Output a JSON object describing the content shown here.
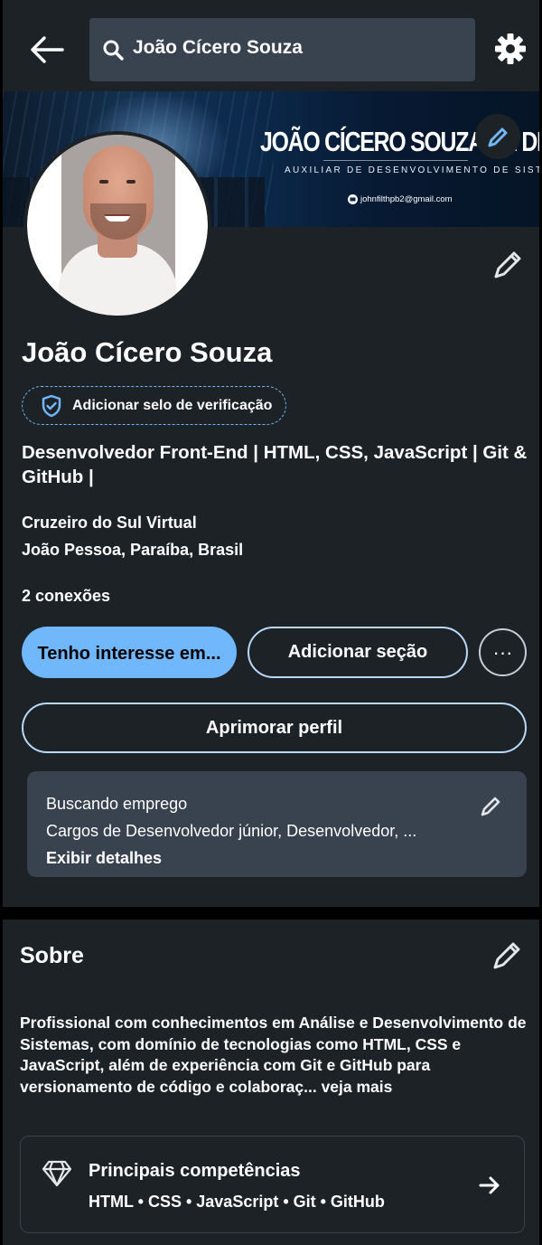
{
  "colors": {
    "page_bg": "#1d2226",
    "accent": "#71b7fb",
    "field_bg": "#38434f"
  },
  "header": {
    "back_icon": "arrow-left-icon",
    "search_value": "João Cícero Souza",
    "search_icon": "search-icon",
    "settings_icon": "gear-icon"
  },
  "banner": {
    "title": "JOÃO CÍCERO SOUZA DE DEUS",
    "subtitle": "AUXILIAR DE DESENVOLVIMENTO DE SISTEMAS",
    "email": "johnfilthpb2@gmail.com"
  },
  "profile": {
    "name": "João Cícero Souza",
    "verify_label": "Adicionar selo de verificação",
    "headline": "Desenvolvedor Front-End | HTML, CSS, JavaScript | Git & GitHub |",
    "school": "Cruzeiro do Sul Virtual",
    "location": "João Pessoa, Paraíba, Brasil",
    "connections": "2 conexões",
    "btn_interest": "Tenho interesse em...",
    "btn_add_section": "Adicionar seção",
    "btn_more": "···",
    "btn_improve": "Aprimorar perfil"
  },
  "job": {
    "title": "Buscando emprego",
    "roles": "Cargos de Desenvolvedor júnior, Desenvolvedor, ...",
    "details_link": "Exibir detalhes"
  },
  "about": {
    "title": "Sobre",
    "text": "Profissional com conhecimentos em Análise e Desenvolvimento de Sistemas, com domínio de tecnologias como HTML, CSS e JavaScript, além de experiência com Git e GitHub para versionamento de código e colaboraç...",
    "more": " veja mais"
  },
  "skills": {
    "title": "Principais competências",
    "list": "HTML • CSS • JavaScript • Git • GitHub"
  }
}
